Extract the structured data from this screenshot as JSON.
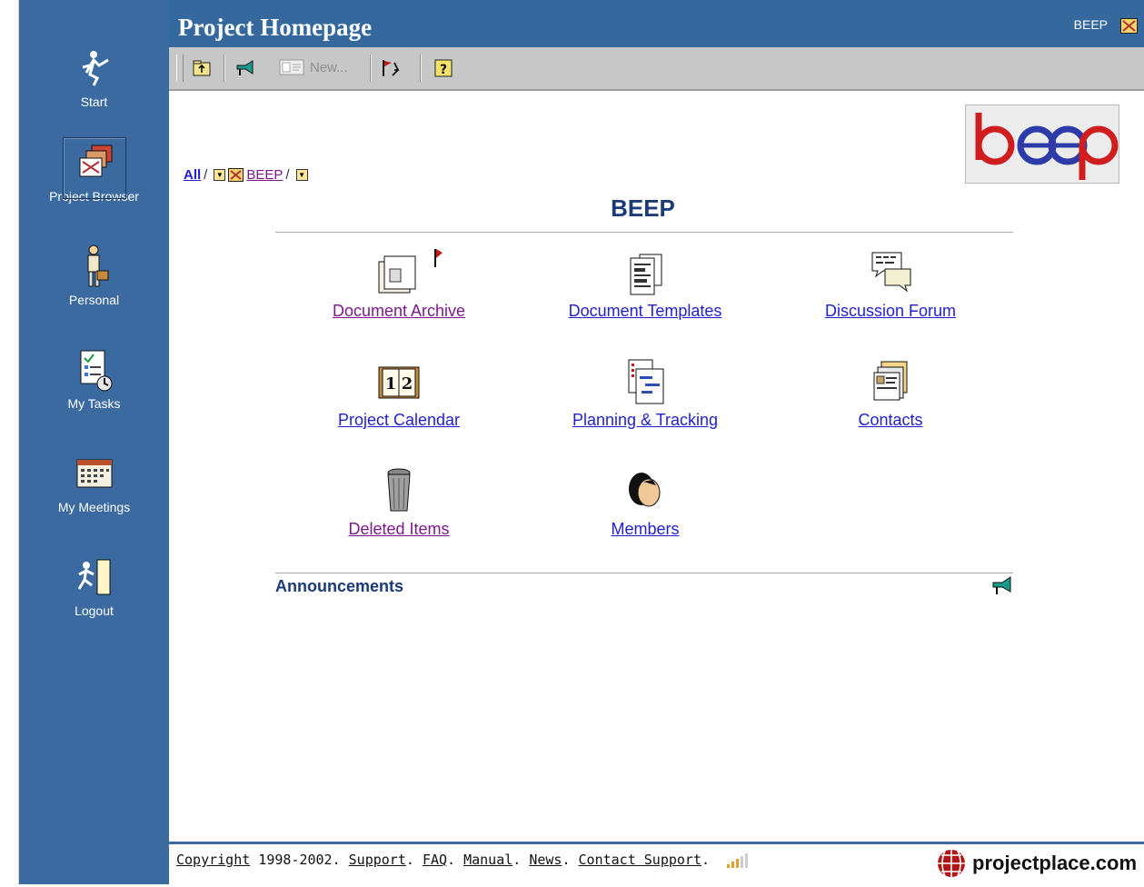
{
  "app": {
    "title": "Project Homepage",
    "project_tag": "BEEP"
  },
  "sidebar": {
    "items": [
      {
        "label": "Start",
        "icon": "start-icon"
      },
      {
        "label": "Project Browser",
        "icon": "project-browser-icon",
        "selected": true
      },
      {
        "label": "Personal",
        "icon": "personal-icon"
      },
      {
        "label": "My Tasks",
        "icon": "my-tasks-icon"
      },
      {
        "label": "My Meetings",
        "icon": "my-meetings-icon"
      },
      {
        "label": "Logout",
        "icon": "logout-icon"
      }
    ]
  },
  "toolbar": {
    "new_label": "New..."
  },
  "breadcrumb": {
    "root": "All",
    "separator": "/",
    "project": "BEEP"
  },
  "project": {
    "heading": "BEEP",
    "logo_text": "beep"
  },
  "tiles": [
    {
      "label": "Document Archive",
      "icon": "document-archive-icon",
      "visited": true
    },
    {
      "label": "Document Templates",
      "icon": "document-templates-icon"
    },
    {
      "label": "Discussion Forum",
      "icon": "discussion-forum-icon"
    },
    {
      "label": "Project Calendar",
      "icon": "project-calendar-icon"
    },
    {
      "label": "Planning & Tracking",
      "icon": "planning-tracking-icon"
    },
    {
      "label": "Contacts",
      "icon": "contacts-icon"
    },
    {
      "label": "Deleted Items",
      "icon": "deleted-items-icon",
      "visited": true
    },
    {
      "label": "Members",
      "icon": "members-icon"
    }
  ],
  "announcements": {
    "title": "Announcements"
  },
  "footer": {
    "copyright": "Copyright",
    "years": " 1998-2002. ",
    "support": "Support",
    "faq": "FAQ",
    "manual": "Manual",
    "news": "News",
    "contact_support": "Contact Support",
    "brand": "projectplace.com"
  },
  "colors": {
    "sidebar": "#3a6aa0",
    "titlebar": "#35689d",
    "toolbar": "#c7c7c7",
    "heading": "#1a3a78",
    "link": "#1f1fd0",
    "visited_link": "#7b1a8a"
  }
}
